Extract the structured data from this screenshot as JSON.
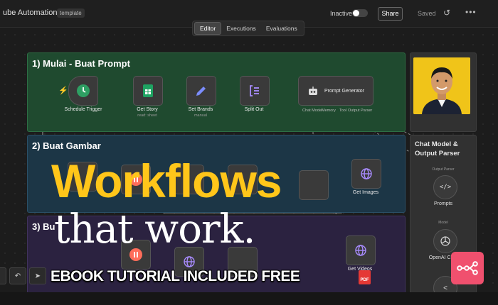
{
  "header": {
    "workflow_name": "ube Automation 1",
    "tag": "template",
    "status_label": "Inactive",
    "share_label": "Share",
    "saved_label": "Saved"
  },
  "tabs": [
    {
      "label": "Editor",
      "active": true
    },
    {
      "label": "Executions",
      "active": false
    },
    {
      "label": "Evaluations",
      "active": false
    }
  ],
  "sections": {
    "prompt": {
      "title": "1) Mulai - Buat Prompt",
      "nodes": [
        {
          "label": "Schedule Trigger",
          "sub": ""
        },
        {
          "label": "Get Story",
          "sub": "read: sheet"
        },
        {
          "label": "Set Brands",
          "sub": "manual"
        },
        {
          "label": "Split Out",
          "sub": ""
        },
        {
          "label": "Prompt Generator",
          "sub": ""
        }
      ],
      "sub_connectors": [
        "Chat Model",
        "Memory",
        "Tool",
        "Output Parser"
      ]
    },
    "image": {
      "title": "2) Buat Gambar",
      "get_images_label": "Get Images"
    },
    "video": {
      "title": "3) Bu",
      "get_videos_label": "Get Videos"
    }
  },
  "side_panel": {
    "title": "Chat Model & Output Parser",
    "items": [
      {
        "tiny": "Output Parser",
        "label": "Prompts"
      },
      {
        "tiny": "Model",
        "label": "OpenAI Chat"
      }
    ]
  },
  "overlay": {
    "headline_line1": "Workflows",
    "headline_line2": "that work.",
    "banner": "EBOOK TUTORIAL INCLUDED FREE",
    "pdf_label": "PDF"
  },
  "colors": {
    "headline": "#ffc61a",
    "section_green": "#1f4a2f",
    "section_blue": "#1c3646",
    "section_purple": "#2b2240",
    "brand": "#f0506e"
  },
  "icons": {
    "history": "history-icon",
    "more": "more-icon",
    "schedule": "clock-icon",
    "sheets": "sheets-icon",
    "edit": "pencil-icon",
    "split": "split-icon",
    "agent": "robot-icon",
    "http": "globe-icon",
    "code": "code-icon",
    "openai": "openai-icon",
    "brand": "workflow-brand-icon"
  }
}
